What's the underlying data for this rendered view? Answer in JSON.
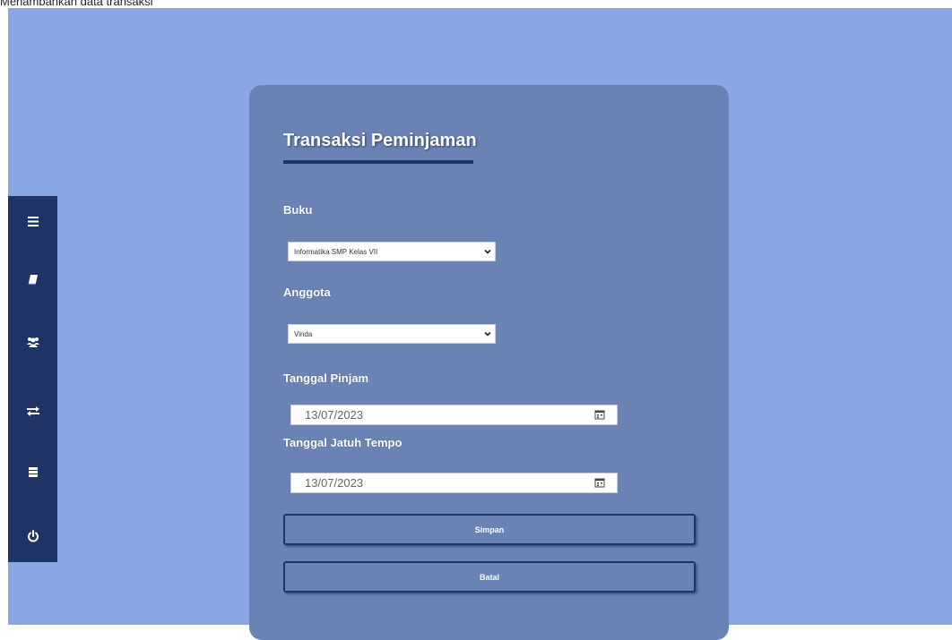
{
  "caption": "Menambahkan data transaksi",
  "sidebar": {
    "items": [
      {
        "icon": "menu-icon"
      },
      {
        "icon": "book-icon"
      },
      {
        "icon": "users-icon"
      },
      {
        "icon": "exchange-icon"
      },
      {
        "icon": "list-icon"
      },
      {
        "icon": "power-icon"
      }
    ]
  },
  "form": {
    "title": "Transaksi Peminjaman",
    "buku": {
      "label": "Buku",
      "value": "Informatika SMP Kelas VII"
    },
    "anggota": {
      "label": "Anggota",
      "value": "Vinda"
    },
    "tanggal_pinjam": {
      "label": "Tanggal Pinjam",
      "value": "13/07/2023"
    },
    "tanggal_jatuh_tempo": {
      "label": "Tanggal Jatuh Tempo",
      "value": "13/07/2023"
    },
    "save_label": "Simpan",
    "cancel_label": "Batal"
  },
  "colors": {
    "background": "#8aa7e4",
    "sidebar": "#1e3465",
    "card": "#6a82b4"
  }
}
